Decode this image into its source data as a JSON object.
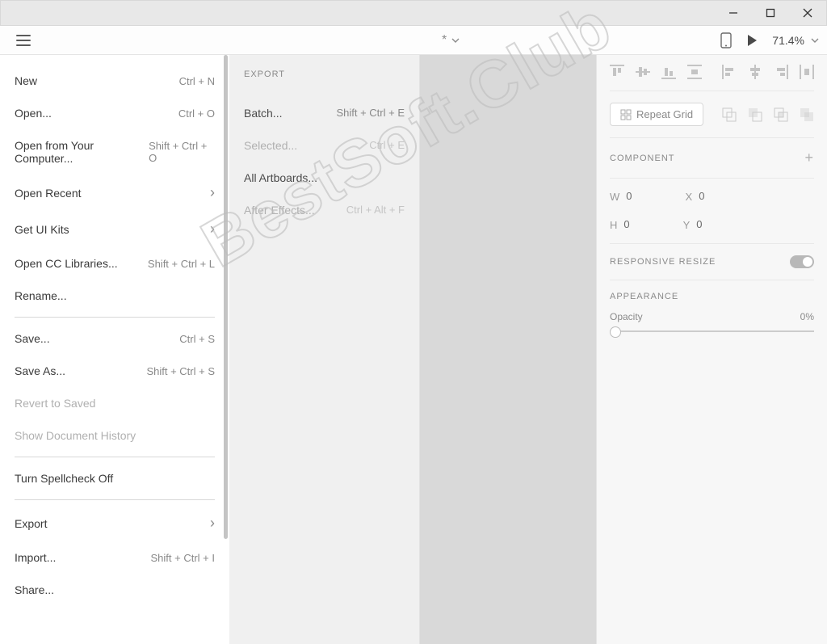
{
  "titlebar": {
    "minimize": "—",
    "maximize": "□",
    "close": "✕"
  },
  "topbar": {
    "doc_indicator": "*",
    "zoom_value": "71.4%"
  },
  "menu": {
    "items": [
      {
        "label": "New",
        "shortcut": "Ctrl + N"
      },
      {
        "label": "Open...",
        "shortcut": "Ctrl + O"
      },
      {
        "label": "Open from Your Computer...",
        "shortcut": "Shift + Ctrl + O"
      },
      {
        "label": "Open Recent"
      },
      {
        "label": "Get UI Kits"
      },
      {
        "label": "Open CC Libraries...",
        "shortcut": "Shift + Ctrl + L"
      },
      {
        "label": "Rename..."
      },
      {
        "label": "Save...",
        "shortcut": "Ctrl + S"
      },
      {
        "label": "Save As...",
        "shortcut": "Shift + Ctrl + S"
      },
      {
        "label": "Revert to Saved"
      },
      {
        "label": "Show Document History"
      },
      {
        "label": "Turn Spellcheck Off"
      },
      {
        "label": "Export"
      },
      {
        "label": "Import...",
        "shortcut": "Shift + Ctrl + I"
      },
      {
        "label": "Share..."
      }
    ]
  },
  "submenu": {
    "title": "EXPORT",
    "items": [
      {
        "label": "Batch...",
        "shortcut": "Shift + Ctrl + E"
      },
      {
        "label": "Selected...",
        "shortcut": "Ctrl + E"
      },
      {
        "label": "All Artboards..."
      },
      {
        "label": "After Effects...",
        "shortcut": "Ctrl + Alt + F"
      }
    ]
  },
  "props": {
    "repeat_label": "Repeat Grid",
    "component_title": "COMPONENT",
    "dims": {
      "w_label": "W",
      "w": "0",
      "x_label": "X",
      "x": "0",
      "h_label": "H",
      "h": "0",
      "y_label": "Y",
      "y": "0"
    },
    "responsive_title": "RESPONSIVE RESIZE",
    "appearance_title": "APPEARANCE",
    "opacity_label": "Opacity",
    "opacity_value": "0%"
  },
  "watermark": "BestSoft.Club"
}
